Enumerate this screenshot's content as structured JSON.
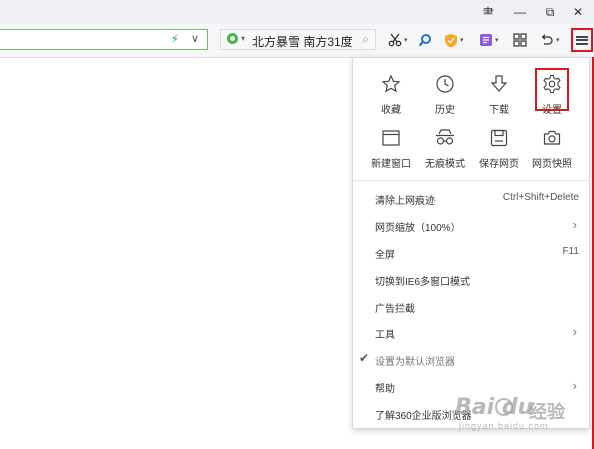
{
  "window": {
    "controls": [
      "skin-icon",
      "minimize-icon",
      "restore-icon",
      "close-icon"
    ],
    "glyphs": {
      "skin": "⺻",
      "minimize": "—",
      "restore": "⧉",
      "close": "✕"
    }
  },
  "toolbar": {
    "address": {
      "value": "",
      "bolt": "⚡",
      "chevron": "∨"
    },
    "search": {
      "text": "北方暴雪 南方31度",
      "dropdown": "▾",
      "mag": "⌕"
    },
    "caret": "▾",
    "accent_color": "#e0151e"
  },
  "menu": {
    "top_icons": [
      {
        "name": "favorites",
        "label": "收藏"
      },
      {
        "name": "history",
        "label": "历史"
      },
      {
        "name": "downloads",
        "label": "下载"
      },
      {
        "name": "settings",
        "label": "设置",
        "highlighted": true
      }
    ],
    "second_icons": [
      {
        "name": "new-window",
        "label": "新建窗口"
      },
      {
        "name": "incognito",
        "label": "无痕模式"
      },
      {
        "name": "save-page",
        "label": "保存网页"
      },
      {
        "name": "snapshot",
        "label": "网页快照"
      }
    ],
    "items": [
      {
        "label": "清除上网痕迹",
        "shortcut": "Ctrl+Shift+Delete"
      },
      {
        "label": "网页缩放（100%）",
        "submenu": "›"
      },
      {
        "label": "全屏",
        "shortcut": "F11"
      },
      {
        "label": "切换到IE6多窗口模式"
      },
      {
        "label": "广告拦截"
      },
      {
        "label": "工具",
        "submenu": "›"
      },
      {
        "label": "设置为默认浏览器",
        "checked": "✔"
      },
      {
        "label": "帮助",
        "submenu": "›"
      },
      {
        "label": "了解360企业版浏览器"
      }
    ]
  },
  "watermark": {
    "brand": "Bai du",
    "suffix": "经验",
    "url": "jingyan.baidu.com"
  }
}
